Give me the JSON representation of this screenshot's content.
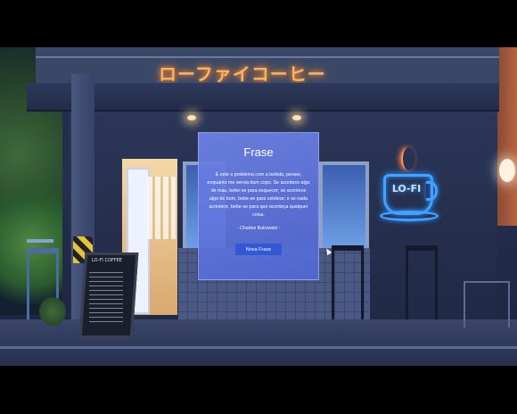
{
  "scene": {
    "sign_text": "ローファイコーヒー",
    "neon_cup_text": "LO-FI",
    "menu_board_title": "LO-FI COFFEE"
  },
  "card": {
    "title": "Frase",
    "quote": "É este o problema com a bebida, pensei, enquanto me servia dum copo. Se acontece algo de mau, bebe-se para esquecer; se acontece algo de bom, bebe-se para celebrar; e se nada acontece, bebe-se para que aconteça qualquer coisa.",
    "author": "- Charles Bukowski -",
    "button_label": "Nova Frase"
  },
  "colors": {
    "card_bg": "#6a82e6",
    "button_bg": "#3358d6",
    "neon_sign": "#ffb25c",
    "neon_cup": "#3ea4ff"
  }
}
